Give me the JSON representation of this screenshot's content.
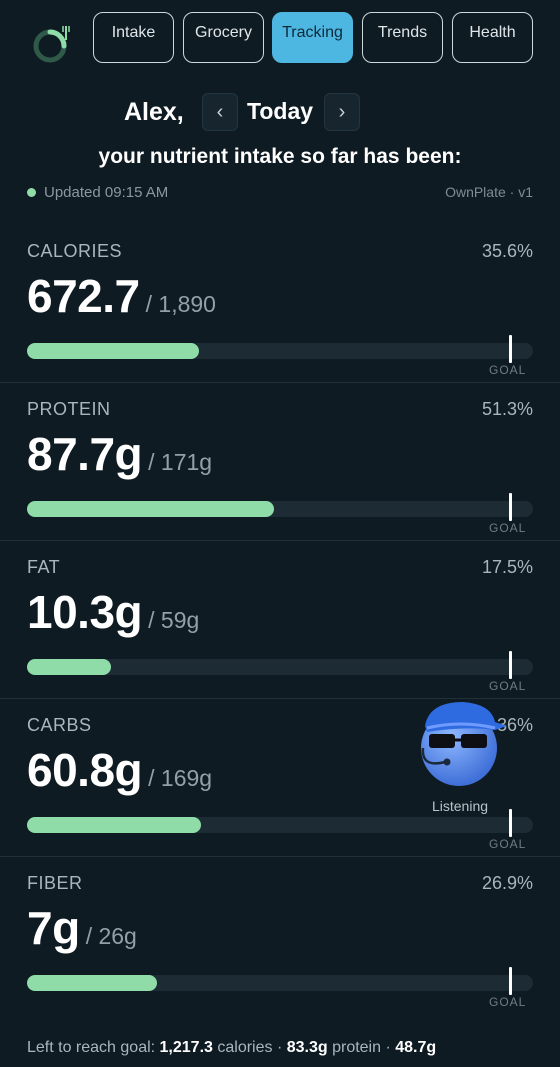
{
  "nav": {
    "logo": "ownplate-logo-icon",
    "tabs": [
      {
        "label": "Intake",
        "active": false
      },
      {
        "label": "Grocery",
        "active": false
      },
      {
        "label": "Tracking",
        "active": true
      },
      {
        "label": "Trends",
        "active": false
      },
      {
        "label": "Health",
        "active": false
      }
    ]
  },
  "header": {
    "user_name": "Alex,",
    "prev_icon": "‹",
    "day_label": "Today",
    "next_icon": "›",
    "subtitle": "your nutrient intake so far has been:"
  },
  "status": {
    "updated": "Updated 09:15 AM",
    "brand": "OwnPlate · v1"
  },
  "nutrients": [
    {
      "label": "CALORIES",
      "percent": "35.6%",
      "value": "672.7",
      "goal": "/ 1,890",
      "fill_fraction": 0.356
    },
    {
      "label": "PROTEIN",
      "percent": "51.3%",
      "value": "87.7g",
      "goal": "/ 171g",
      "fill_fraction": 0.513
    },
    {
      "label": "FAT",
      "percent": "17.5%",
      "value": "10.3g",
      "goal": "/ 59g",
      "fill_fraction": 0.175
    },
    {
      "label": "CARBS",
      "percent": "36%",
      "value": "60.8g",
      "goal": "/ 169g",
      "fill_fraction": 0.36
    },
    {
      "label": "FIBER",
      "percent": "26.9%",
      "value": "7g",
      "goal": "/ 26g",
      "fill_fraction": 0.269
    }
  ],
  "goal_marker_label": "GOAL",
  "assistant": {
    "icon": "assistant-avatar-icon",
    "status": "Listening"
  },
  "footer": {
    "prefix": "Left to reach goal: ",
    "calories_value": "1,217.3",
    "calories_unit": " calories · ",
    "protein_value": "83.3g",
    "protein_unit": " protein · ",
    "fat_value": "48.7g"
  },
  "colors": {
    "background": "#0f1b22",
    "accent": "#4db7e2",
    "bar_fill": "#8fdca9",
    "bar_track": "#1d2b34"
  }
}
